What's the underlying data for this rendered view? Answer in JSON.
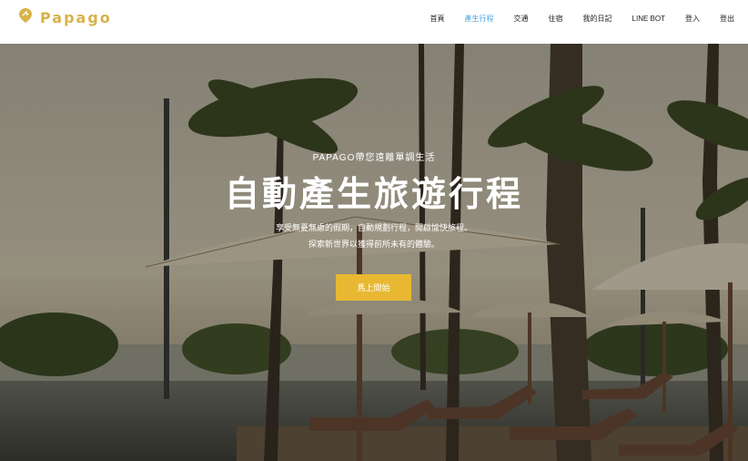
{
  "brand": {
    "name": "Papago",
    "icon": "pin-icon",
    "color": "#d8b24a"
  },
  "nav": {
    "items": [
      {
        "label": "首頁",
        "active": false
      },
      {
        "label": "產生行程",
        "active": true
      },
      {
        "label": "交通",
        "active": false
      },
      {
        "label": "住宿",
        "active": false
      },
      {
        "label": "我的日記",
        "active": false
      },
      {
        "label": "LINE BOT",
        "active": false
      },
      {
        "label": "登入",
        "active": false
      },
      {
        "label": "登出",
        "active": false
      }
    ],
    "active_color": "#4aa3df"
  },
  "hero": {
    "tagline": "PAPAGO帶您遠離單調生活",
    "headline": "自動產生旅遊行程",
    "description_line1": "享受無憂無慮的假期，自動規劃行程，開啟愉快旅程。",
    "description_line2": "探索新世界以獲得前所未有的體驗。",
    "cta_label": "馬上開始",
    "cta_color": "#e8b832",
    "background": "tropical-resort-palm-trees-umbrellas-photo"
  }
}
